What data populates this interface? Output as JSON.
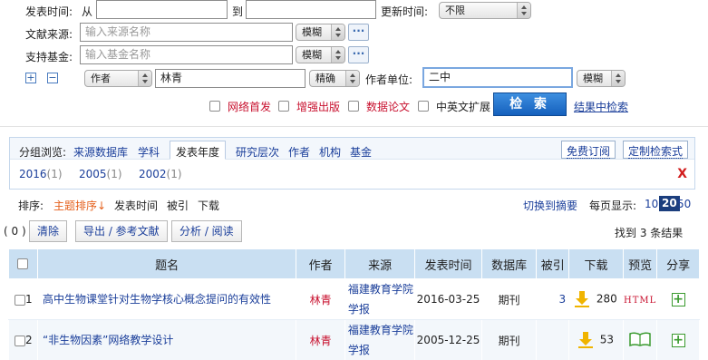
{
  "search": {
    "pub_time_label": "发表时间:",
    "from_label": "从",
    "to_label": "到",
    "update_time_label": "更新时间:",
    "update_time_value": "不限",
    "source_label": "文献来源:",
    "source_placeholder": "输入来源名称",
    "source_match": "模糊",
    "fund_label": "支持基金:",
    "fund_placeholder": "输入基金名称",
    "fund_match": "模糊",
    "field_select": "作者",
    "author_value": "林青",
    "author_match": "精确",
    "org_label": "作者单位:",
    "org_value": "二中",
    "org_match": "模糊",
    "more_dots": "···",
    "plus": "+",
    "minus": "−",
    "checkboxes": [
      "网络首发",
      "增强出版",
      "数据论文",
      "中英文扩展"
    ],
    "search_button": "检 索",
    "search_in_results": "结果中检索"
  },
  "group": {
    "label": "分组浏览:",
    "tabs": [
      "来源数据库",
      "学科",
      "发表年度",
      "研究层次",
      "作者",
      "机构",
      "基金"
    ],
    "active_tab": "发表年度",
    "free_subscribe": "免费订阅",
    "custom_search": "定制检索式",
    "years": [
      {
        "year": "2016",
        "count": "(1)"
      },
      {
        "year": "2005",
        "count": "(1)"
      },
      {
        "year": "2002",
        "count": "(1)"
      }
    ],
    "close": "X"
  },
  "sort": {
    "label": "排序:",
    "items": [
      "主题排序↓",
      "发表时间",
      "被引",
      "下载"
    ],
    "switch_abstract": "切换到摘要",
    "per_page_label": "每页显示:",
    "page_sizes": [
      "10",
      "20",
      "50"
    ],
    "active_page_size": "20"
  },
  "actions": {
    "selected_count": "( 0 )",
    "clear": "清除",
    "export": "导出 / 参考文献",
    "analyze": "分析 / 阅读",
    "found": "找到 3 条结果"
  },
  "table": {
    "headers": [
      "题名",
      "作者",
      "来源",
      "发表时间",
      "数据库",
      "被引",
      "下载",
      "预览",
      "分享"
    ],
    "rows": [
      {
        "num": "1",
        "title": "高中生物课堂针对生物学核心概念提问的有效性",
        "author": "林青",
        "source": "福建教育学院学报",
        "date": "2016-03-25",
        "db": "期刊",
        "cite": "3",
        "downloads": "280",
        "preview": "HTML",
        "share": "+"
      },
      {
        "num": "2",
        "title": "“非生物因素”网络教学设计",
        "author": "林青",
        "source": "福建教育学院学报",
        "date": "2005-12-25",
        "db": "期刊",
        "cite": "",
        "downloads": "53",
        "preview": "book-icon",
        "share": "+"
      }
    ]
  },
  "colors": {
    "accent_blue": "#1a3e9a",
    "header_bg": "#c9dff2",
    "red": "#c8102e",
    "sort_active": "#e5601c",
    "download_yellow": "#f0b400"
  }
}
